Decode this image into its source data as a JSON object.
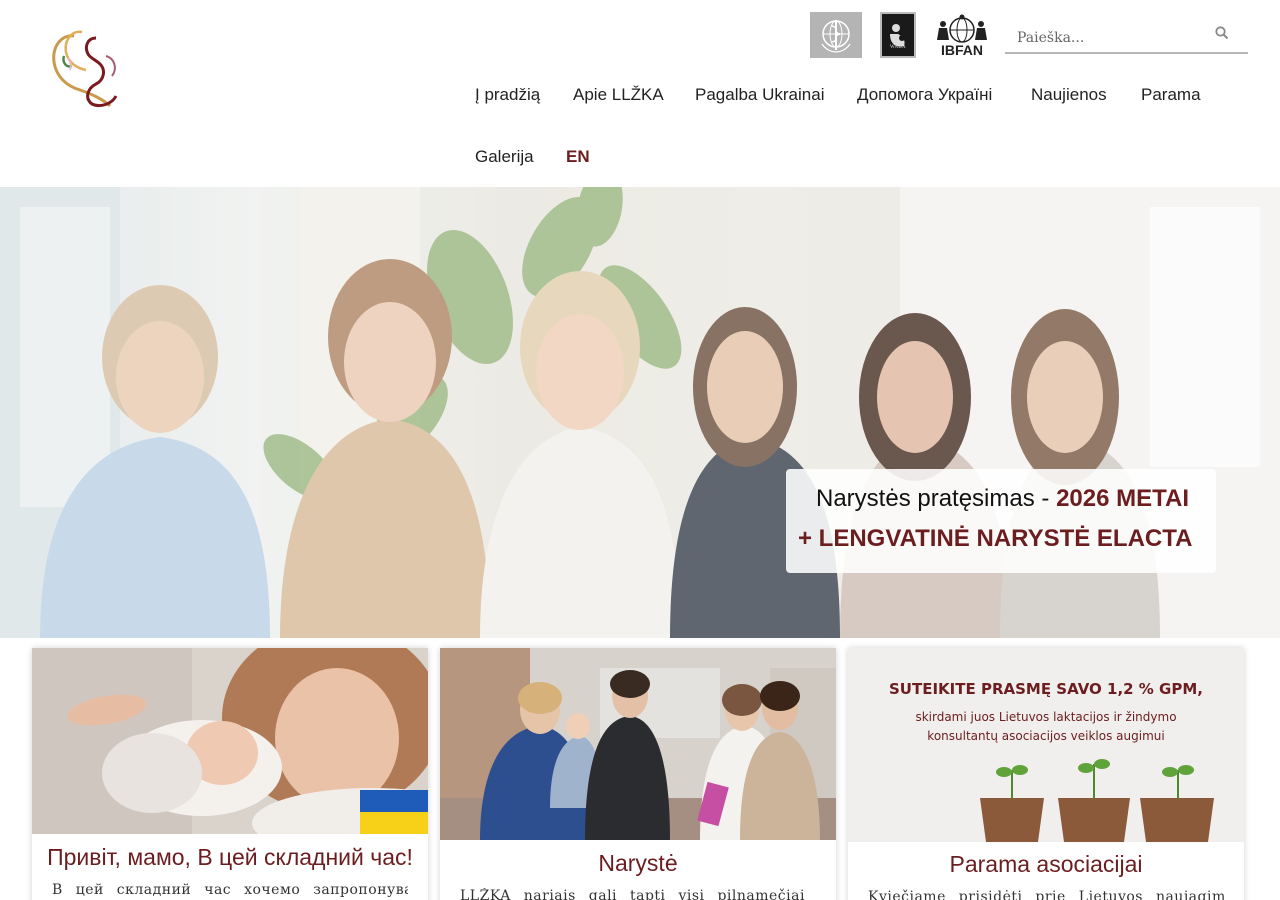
{
  "site": {
    "logo_name": "LLŽKA logo"
  },
  "partners": {
    "who": "who-logo",
    "waba": "WABA",
    "ibfan": "IBFAN"
  },
  "search": {
    "placeholder": "Paieška..."
  },
  "nav": {
    "items": [
      {
        "label": "Į pradžią"
      },
      {
        "label": "Apie LLŽKA"
      },
      {
        "label": "Pagalba Ukrainai"
      },
      {
        "label": "Допомога Україні"
      },
      {
        "label": "Naujienos"
      },
      {
        "label": "Parama"
      },
      {
        "label": "Galerija"
      },
      {
        "label": "EN"
      }
    ]
  },
  "hero": {
    "banner_line1_prefix": "Narystės pratęsimas -",
    "banner_line1_highlight": "2026 METAI",
    "banner_line2": "+ LENGVATINĖ NARYSTĖ ELACTA"
  },
  "cards": [
    {
      "title": "Привіт, мамо, В цей складний час!",
      "text": "В цей складний час хочемо запропонувати"
    },
    {
      "title": "Narystė",
      "text": "LLŽKA nariais gali tapti visi pilnamečiai asmenys"
    },
    {
      "title": "Parama asociacijai",
      "text": "Kviečiame prisidėti prie Lietuvos naujagimių, kūdikių",
      "image_text": {
        "line1": "SUTEIKITE PRASMĘ SAVO 1,2 % GPM,",
        "line2": "skirdami juos Lietuvos laktacijos ir žindymo",
        "line3": "konsultantų asociacijos veiklos augimui"
      }
    }
  ],
  "colors": {
    "brand": "#6c1d1f",
    "ukraine_blue": "#1f5bb8",
    "ukraine_yellow": "#f7d117"
  }
}
